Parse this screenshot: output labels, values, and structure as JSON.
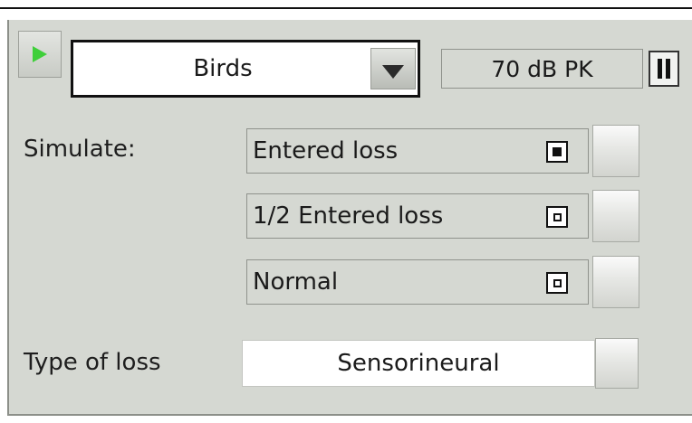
{
  "player": {
    "sound_selected": "Birds",
    "level_readout": "70 dB PK"
  },
  "simulate": {
    "label": "Simulate:",
    "options": [
      {
        "label": "Entered loss",
        "selected": true
      },
      {
        "label": "1/2 Entered loss",
        "selected": false
      },
      {
        "label": "Normal",
        "selected": false
      }
    ]
  },
  "loss_type": {
    "label": "Type of loss",
    "value": "Sensorineural"
  },
  "icons": {
    "play": "play-icon",
    "dropdown": "chevron-down-icon",
    "pause": "pause-icon"
  },
  "colors": {
    "panel_bg": "#d5d8d2",
    "play_green": "#3fcf3a"
  }
}
